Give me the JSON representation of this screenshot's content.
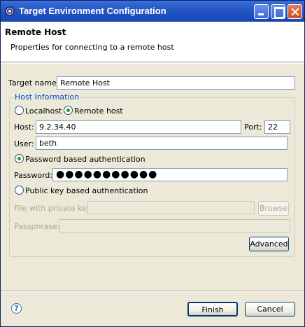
{
  "window": {
    "title": "Target Environment Configuration"
  },
  "banner": {
    "title": "Remote Host",
    "description": "Properties for connecting to a remote host"
  },
  "form": {
    "target_name_label": "Target name:",
    "target_name_value": "Remote Host",
    "group_title": "Host Information",
    "localhost_label": "Localhost",
    "remote_host_label": "Remote host",
    "host_label": "Host:",
    "host_value": "9.2.34.40",
    "port_label": "Port:",
    "port_value": "22",
    "user_label": "User:",
    "user_value": "beth",
    "password_auth_label": "Password based authentication",
    "password_label": "Password:",
    "password_value": "●●●●●●●●●●●",
    "pubkey_auth_label": "Public key based authentication",
    "private_key_label": "File with private key:",
    "private_key_value": "",
    "browse_label": "Browse",
    "passphrase_label": "Passphrase:",
    "passphrase_value": "",
    "advanced_label": "Advanced"
  },
  "footer": {
    "help_icon": "?",
    "finish_label": "Finish",
    "cancel_label": "Cancel"
  }
}
